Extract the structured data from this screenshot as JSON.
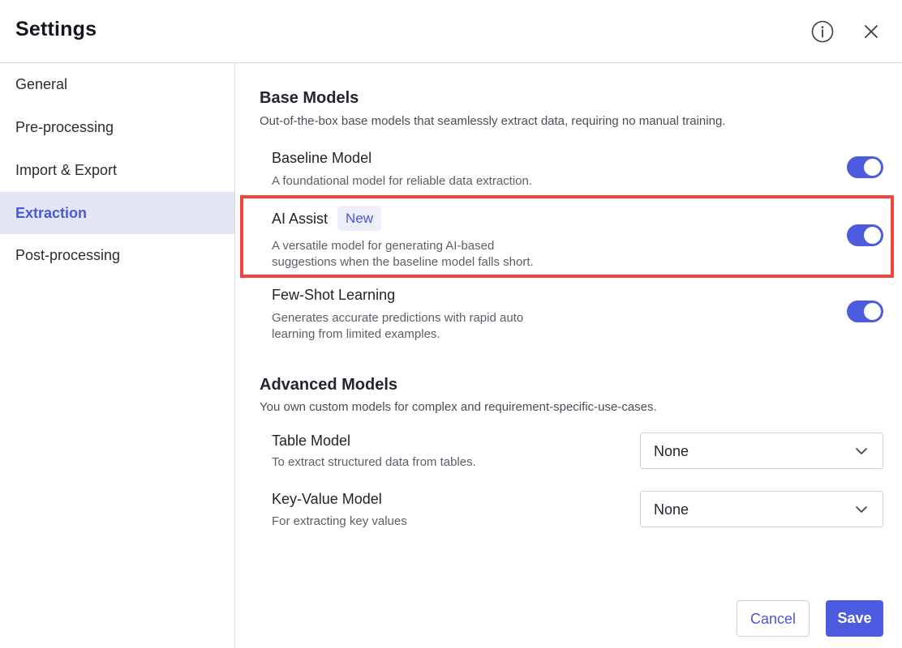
{
  "header": {
    "title": "Settings",
    "info_icon": "info-icon",
    "close_icon": "close-icon"
  },
  "sidebar": {
    "items": [
      {
        "label": "General",
        "active": false
      },
      {
        "label": "Pre-processing",
        "active": false
      },
      {
        "label": "Import & Export",
        "active": false
      },
      {
        "label": "Extraction",
        "active": true
      },
      {
        "label": "Post-processing",
        "active": false
      }
    ]
  },
  "base_models": {
    "title": "Base Models",
    "description": "Out-of-the-box base models that seamlessly extract data, requiring no manual training.",
    "options": [
      {
        "name": "Baseline Model",
        "description": "A foundational model for reliable data extraction.",
        "enabled": true
      },
      {
        "name": "AI Assist",
        "badge": "New",
        "description_line1": "A versatile model for generating AI-based",
        "description_line2": "suggestions when the baseline model falls short.",
        "enabled": true
      },
      {
        "name": "Few-Shot Learning",
        "description_line1": "Generates accurate predictions with rapid auto",
        "description_line2": "learning from limited examples.",
        "enabled": true
      }
    ]
  },
  "advanced_models": {
    "title": "Advanced Models",
    "description": "You own custom models for complex and requirement-specific-use-cases.",
    "options": [
      {
        "name": "Table Model",
        "description": "To extract structured data from tables.",
        "selected": "None"
      },
      {
        "name": "Key-Value Model",
        "description": "For extracting key values",
        "selected": "None"
      }
    ]
  },
  "footer": {
    "cancel_label": "Cancel",
    "save_label": "Save"
  },
  "colors": {
    "accent": "#4d5be0",
    "highlight_border": "#f0463e",
    "active_nav_bg": "#e3e6f5"
  }
}
